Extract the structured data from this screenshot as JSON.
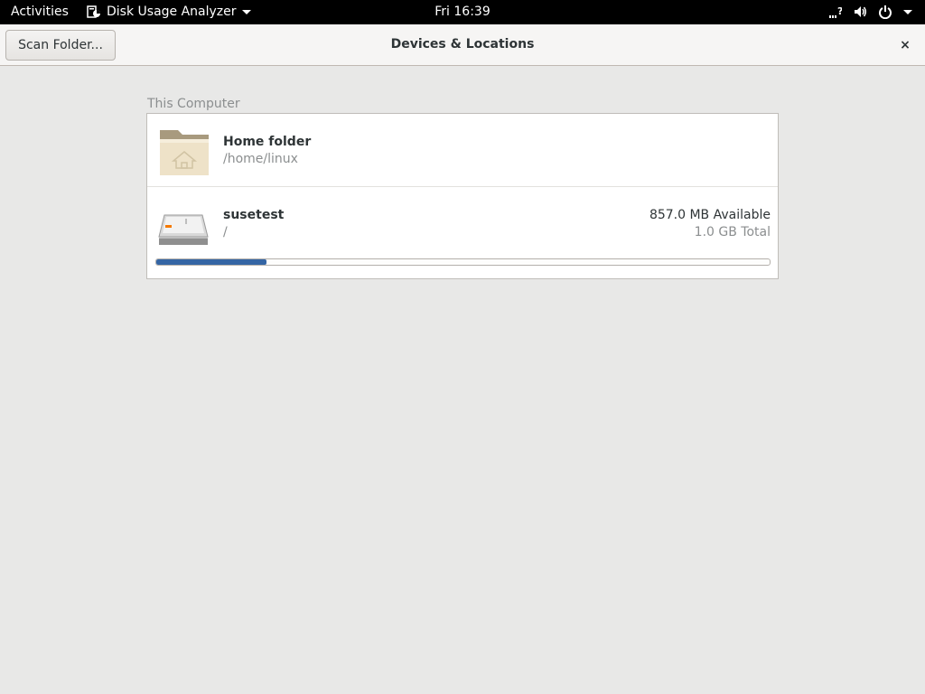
{
  "topbar": {
    "activities": "Activities",
    "app_name": "Disk Usage Analyzer",
    "clock": "Fri 16:39",
    "tray_icons": [
      "network-unknown-icon",
      "volume-icon",
      "power-icon"
    ]
  },
  "header": {
    "scan_label": "Scan Folder...",
    "title": "Devices & Locations",
    "close_label": "×"
  },
  "section": {
    "label": "This Computer"
  },
  "devices": [
    {
      "name": "Home folder",
      "path": "/home/linux",
      "icon": "home-folder-icon"
    },
    {
      "name": "susetest",
      "path": "/",
      "available": "857.0 MB Available",
      "total": "1.0 GB Total",
      "icon": "hard-disk-icon",
      "usage_fraction": 0.18
    }
  ],
  "colors": {
    "usage_fill": "#3465a4",
    "topbar_bg": "#000000",
    "window_bg": "#e8e8e7"
  }
}
